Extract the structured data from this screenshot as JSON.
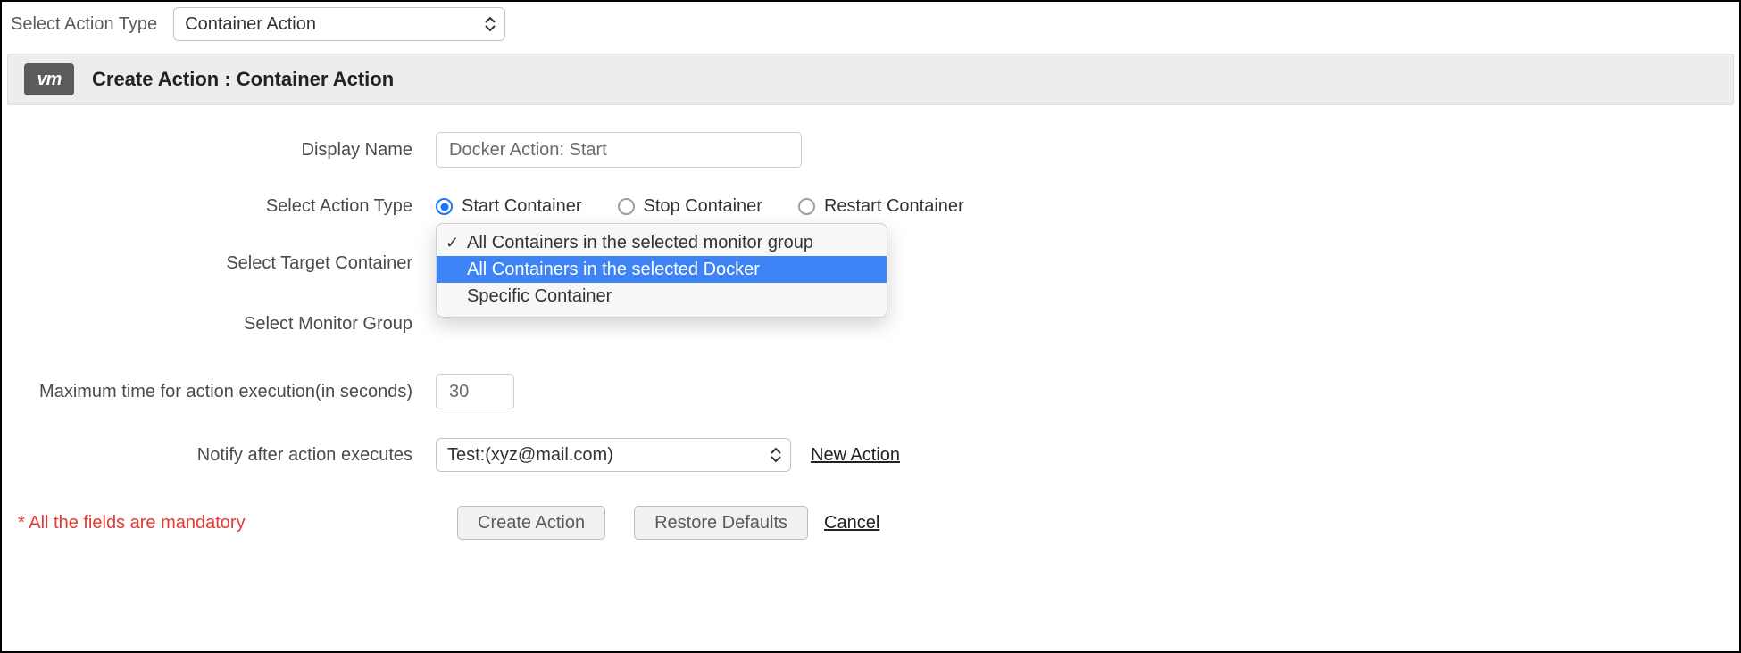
{
  "top": {
    "label": "Select Action Type",
    "selected": "Container Action"
  },
  "header": {
    "icon_text": "vm",
    "title": "Create Action : Container Action"
  },
  "form": {
    "display_name_label": "Display Name",
    "display_name_value": "Docker Action: Start",
    "action_type_label": "Select Action Type",
    "radio_options": {
      "start": "Start Container",
      "stop": "Stop Container",
      "restart": "Restart Container"
    },
    "radio_selected": "start",
    "target_container_label": "Select Target Container",
    "target_dropdown": {
      "selected_index": 0,
      "highlighted_index": 1,
      "options": [
        "All Containers in the selected monitor group",
        "All Containers in the selected Docker",
        "Specific Container"
      ]
    },
    "monitor_group_label": "Select Monitor Group",
    "max_time_label": "Maximum time for action execution(in seconds)",
    "max_time_value": "30",
    "notify_label": "Notify after action executes",
    "notify_value": "Test:(xyz@mail.com)",
    "new_action_link": "New Action"
  },
  "footer": {
    "mandatory_note": "* All the fields are mandatory",
    "create_btn": "Create Action",
    "restore_btn": "Restore Defaults",
    "cancel_link": "Cancel"
  }
}
